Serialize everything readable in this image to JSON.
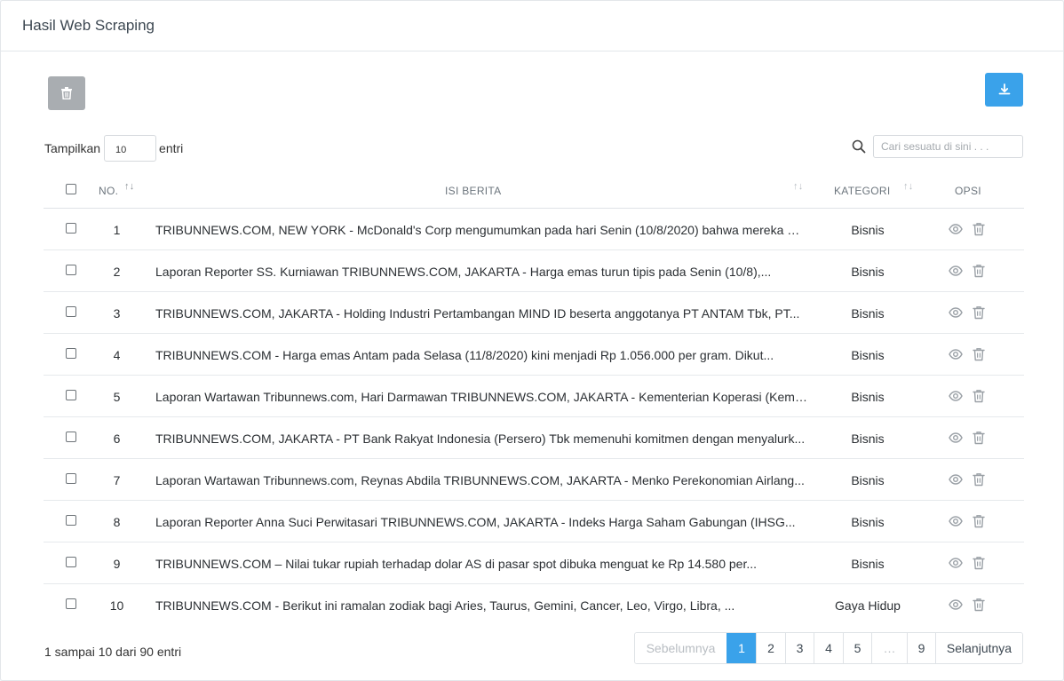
{
  "header": {
    "title": "Hasil Web Scraping"
  },
  "toolbar": {
    "delete_icon": "trash-icon",
    "download_icon": "download-icon"
  },
  "length": {
    "prefix": "Tampilkan",
    "value": "10",
    "suffix": "entri"
  },
  "search": {
    "placeholder": "Cari sesuatu di sini . . ."
  },
  "table": {
    "columns": {
      "no": "NO.",
      "isi": "ISI BERITA",
      "kategori": "KATEGORI",
      "opsi": "OPSI"
    },
    "rows": [
      {
        "no": "1",
        "isi": "TRIBUNNEWS.COM, NEW YORK - McDonald's Corp mengumumkan pada hari Senin (10/8/2020) bahwa mereka menggugat",
        "kategori": "Bisnis"
      },
      {
        "no": "2",
        "isi": "Laporan Reporter SS. Kurniawan  TRIBUNNEWS.COM, JAKARTA - Harga emas turun tipis pada Senin (10/8),...",
        "kategori": "Bisnis"
      },
      {
        "no": "3",
        "isi": "TRIBUNNEWS.COM, JAKARTA - Holding Industri Pertambangan MIND ID beserta anggotanya PT ANTAM Tbk, PT...",
        "kategori": "Bisnis"
      },
      {
        "no": "4",
        "isi": "TRIBUNNEWS.COM - Harga emas Antam pada Selasa (11/8/2020) kini menjadi Rp 1.056.000 per gram. Dikut...",
        "kategori": "Bisnis"
      },
      {
        "no": "5",
        "isi": "Laporan Wartawan Tribunnews.com, Hari Darmawan TRIBUNNEWS.COM, JAKARTA - Kementerian Koperasi (Keme...",
        "kategori": "Bisnis"
      },
      {
        "no": "6",
        "isi": "TRIBUNNEWS.COM, JAKARTA - PT Bank Rakyat Indonesia (Persero) Tbk memenuhi komitmen dengan menyalurk...",
        "kategori": "Bisnis"
      },
      {
        "no": "7",
        "isi": "Laporan Wartawan Tribunnews.com, Reynas Abdila TRIBUNNEWS.COM, JAKARTA - Menko Perekonomian Airlang...",
        "kategori": "Bisnis"
      },
      {
        "no": "8",
        "isi": "Laporan Reporter Anna Suci Perwitasari TRIBUNNEWS.COM, JAKARTA - Indeks Harga Saham Gabungan (IHSG...",
        "kategori": "Bisnis"
      },
      {
        "no": "9",
        "isi": "TRIBUNNEWS.COM – Nilai tukar rupiah terhadap dolar AS di pasar spot dibuka menguat ke Rp 14.580 per...",
        "kategori": "Bisnis"
      },
      {
        "no": "10",
        "isi": "TRIBUNNEWS.COM - Berikut ini ramalan zodiak bagi Aries, Taurus, Gemini, Cancer, Leo, Virgo, Libra, ...",
        "kategori": "Gaya Hidup"
      }
    ],
    "action_icons": [
      "eye-icon",
      "trash-icon"
    ]
  },
  "info": "1 sampai 10 dari 90 entri",
  "pagination": {
    "prev": "Sebelumnya",
    "pages": [
      "1",
      "2",
      "3",
      "4",
      "5",
      "…",
      "9"
    ],
    "active": "1",
    "next": "Selanjutnya"
  },
  "colors": {
    "primary": "#3aa2ea",
    "secondary": "#a9adb1"
  }
}
